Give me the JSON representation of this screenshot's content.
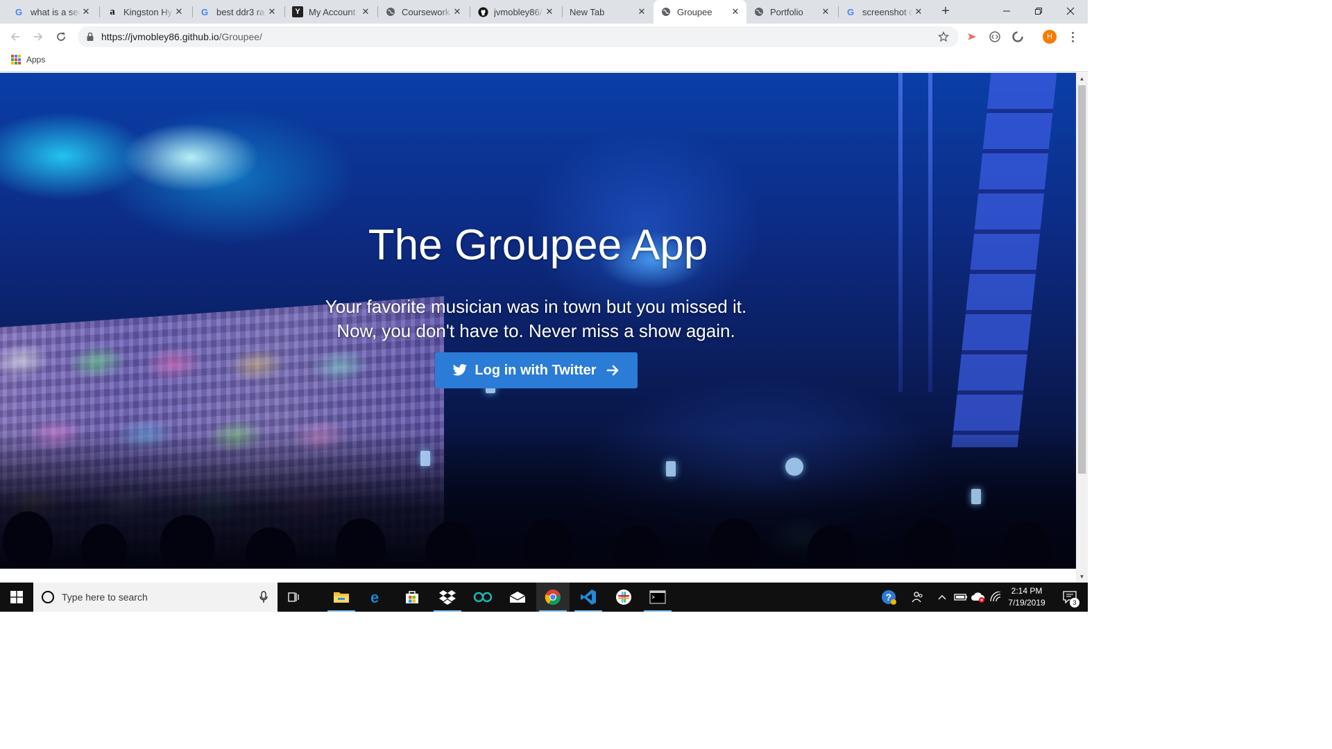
{
  "browser": {
    "tabs": [
      {
        "title": "what is a sec",
        "favicon": "google-icon",
        "active": false
      },
      {
        "title": "Kingston Hy",
        "favicon": "amazon-icon",
        "active": false
      },
      {
        "title": "best ddr3 ra",
        "favicon": "google-icon",
        "active": false
      },
      {
        "title": "My Account",
        "favicon": "yahoo-icon",
        "active": false
      },
      {
        "title": "Coursework",
        "favicon": "globe-icon",
        "active": false
      },
      {
        "title": "jvmobley86/",
        "favicon": "github-icon",
        "active": false
      },
      {
        "title": "New Tab",
        "favicon": "",
        "active": false
      },
      {
        "title": "Groupee",
        "favicon": "globe-icon",
        "active": true
      },
      {
        "title": "Portfolio",
        "favicon": "globe-icon",
        "active": false
      },
      {
        "title": "screenshot c",
        "favicon": "google-icon",
        "active": false
      }
    ],
    "url_host": "https://jvmobley86.github.io",
    "url_path": "/Groupee/",
    "profile_initial": "H",
    "bookmarks": {
      "apps_label": "Apps"
    }
  },
  "page": {
    "title": "The Groupee App",
    "subtitle_line1": "Your favorite musician was in town but you missed it.",
    "subtitle_line2": "Now, you don't have to. Never miss a show again.",
    "login_button_label": "Log in with Twitter",
    "accent_color": "#2a7cd6"
  },
  "taskbar": {
    "search_placeholder": "Type here to search",
    "time": "2:14 PM",
    "date": "7/19/2019",
    "notification_count": "3",
    "pinned_apps": [
      "task-view-icon",
      "file-explorer-icon",
      "edge-icon",
      "store-icon",
      "dropbox-icon",
      "arduino-icon",
      "mail-icon",
      "chrome-icon",
      "vscode-icon",
      "slack-icon",
      "terminal-icon"
    ]
  }
}
